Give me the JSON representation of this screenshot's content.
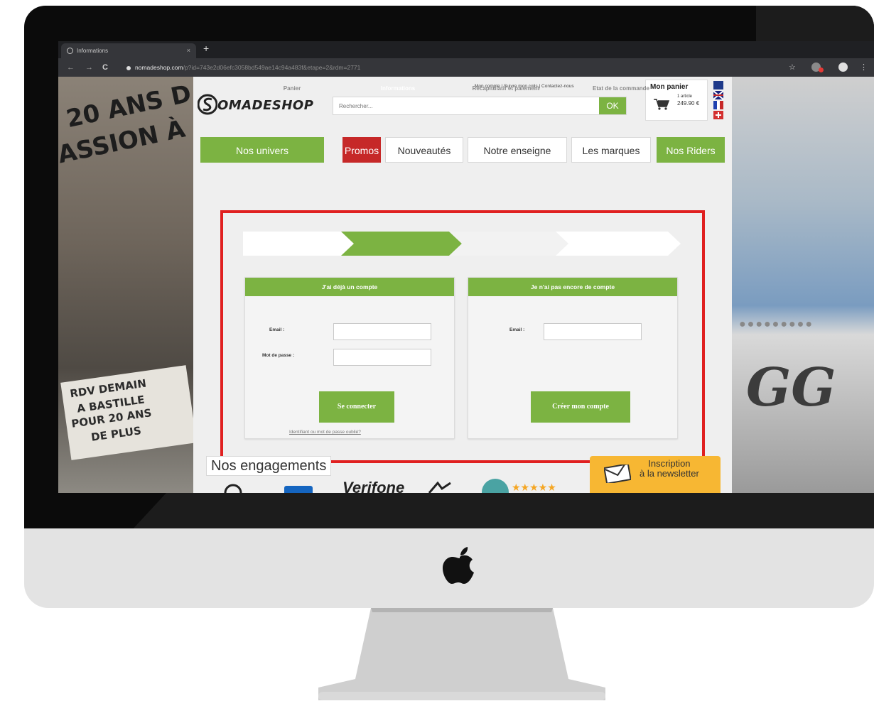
{
  "browser": {
    "tab_title": "Informations",
    "tab_close": "×",
    "new_tab": "+",
    "url_domain": "nomadeshop.com",
    "url_rest": "/p?id=743e2d06efc3058bd549ae14c94a483f&etape=2&rdm=2771",
    "nav_back": "←",
    "nav_forward": "→",
    "nav_reload": "C",
    "star": "☆"
  },
  "background": {
    "left_text_1": "20 ANS D",
    "left_text_2": "ASSION À",
    "left_rdv_1": "RDV DEMAIN",
    "left_rdv_2": "A BASTILLE",
    "left_rdv_3": "POUR 20 ANS",
    "left_rdv_4": "DE PLUS",
    "right_text": "GG"
  },
  "header": {
    "logo": "OMADESHOP",
    "search_placeholder": "Rechercher...",
    "ok_label": "OK",
    "top_links": "Mon compte  |  Suivre mon colis  |  Contactez-nous",
    "cart": {
      "title": "Mon panier",
      "count": "1 article",
      "price": "249.90 €"
    }
  },
  "menu": [
    {
      "label": "Nos univers"
    },
    {
      "label": "Promos"
    },
    {
      "label": "Nouveautés"
    },
    {
      "label": "Notre enseigne"
    },
    {
      "label": "Les marques"
    },
    {
      "label": "Nos Riders"
    }
  ],
  "steps": [
    {
      "label": "Panier"
    },
    {
      "label": "Informations"
    },
    {
      "label": "Récapitulatif et paiement"
    },
    {
      "label": "Etat de la commande"
    }
  ],
  "login": {
    "title": "J'ai déjà un compte",
    "email_label": "Email :",
    "password_label": "Mot de passe :",
    "button": "Se connecter",
    "forgot": "Identifiant ou mot de passe oublié?"
  },
  "register": {
    "title": "Je n'ai pas encore de compte",
    "email_label": "Email :",
    "button": "Créer mon compte"
  },
  "footer": {
    "engagements": "Nos engagements",
    "newsletter": "Inscription à la newsletter",
    "newsletter_line1": "Inscription",
    "newsletter_line2": "à la newsletter",
    "verifone": "Verifone",
    "stars": "★★★★★"
  },
  "colors": {
    "brand_green": "#7cb342",
    "promo_red": "#c62828",
    "highlight_red": "#e02020",
    "newsletter_orange": "#f7b733"
  }
}
